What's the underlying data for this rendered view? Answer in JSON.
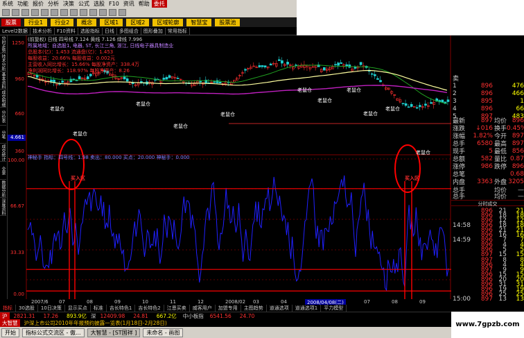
{
  "menu": [
    "系统",
    "功能",
    "报价",
    "分析",
    "决策",
    "公式",
    "选股",
    "F10",
    "资讯",
    "帮助",
    "委托"
  ],
  "toolbar_icons": [
    "open-icon",
    "save-icon",
    "kline-icon",
    "rsi-icon",
    "grid-icon",
    "cross-icon",
    "zoom-in-icon",
    "zoom-out-icon",
    "prev-icon",
    "next-icon",
    "period-icon",
    "search-icon",
    "refresh-icon"
  ],
  "tabs": [
    "股票",
    "行业1",
    "行业2",
    "概念",
    "区域1",
    "区域2",
    "区域轮廓",
    "智慧宝",
    "股票池"
  ],
  "subbar": [
    "Level2数据",
    "技术分析",
    "F10资料",
    "选股指标",
    "日线",
    "多图组合",
    "图形叠加",
    "常用指标"
  ],
  "leftnav": [
    "分时走势",
    "技术分析",
    "基本资料",
    "成交明细",
    "分价表",
    "分笔",
    "成交统计",
    "全景",
    "数据分析",
    "深度资料"
  ],
  "chart": {
    "header": "(前复权)  日线  四号线 7.124  黄线  7.126  绿线 7.996",
    "info_lines": [
      "所属地域：自选股1, 电器, ST, 长江三角, 浙江, 日线电子器具制造业",
      "总股本(亿)：1.453    流通盘(亿)：1.453",
      "每股收益：20.66%    每股收益：0.002元",
      "主营收入同比增长：15.66%  每股净资产：338.4万",
      "净利润同比增长：118.97%  每股净资产：8.26"
    ],
    "kline_axis": [
      "1250",
      "960",
      "660",
      "360"
    ],
    "kline_axis_value": "4.661",
    "labels": [
      "老鼠仓",
      "老鼠仓",
      "老鼠仓",
      "老鼠仓",
      "老鼠仓",
      "老鼠仓",
      "老鼠仓",
      "老鼠仓",
      "老鼠仓",
      "老鼠仓",
      "老鼠仓"
    ],
    "osc_header": "神秘手  指标：四号线：1.98  卖出：80.000  买点：20.000  神秘手：0.000",
    "osc_axis": [
      "100.00",
      "66.67",
      "33.33",
      "0.00"
    ],
    "buy_label_left": "买入区",
    "buy_label_right": "买入区",
    "current_date": "2008/04/08(二)",
    "x_labels": [
      "2007/6",
      "07",
      "08",
      "09",
      "10",
      "11",
      "12",
      "2008/02",
      "03",
      "04",
      "05",
      "06",
      "07",
      "08",
      "09"
    ]
  },
  "quote_rows": [
    {
      "n": "卖",
      "p": "",
      "v": "",
      "q": ""
    },
    {
      "n": "1",
      "p": "896",
      "v": "",
      "q": "476"
    },
    {
      "n": "2",
      "p": "896",
      "v": "",
      "q": "466"
    },
    {
      "n": "3",
      "p": "895",
      "v": "",
      "q": "1"
    },
    {
      "n": "4",
      "p": "896",
      "v": "",
      "q": "66"
    },
    {
      "n": "5",
      "p": "897",
      "v": "",
      "q": "483"
    }
  ],
  "stat_rows": [
    {
      "a": "最新",
      "b": "897",
      "c": "均价",
      "d": "896"
    },
    {
      "a": "涨跌",
      "b": "↓016",
      "c": "换手",
      "d": "0.45%"
    },
    {
      "a": "涨幅",
      "b": "1.82%",
      "c": "今开",
      "d": "897"
    },
    {
      "a": "总手",
      "b": "6580",
      "c": "最高",
      "d": "897"
    },
    {
      "a": "现手",
      "b": "5",
      "c": "最低",
      "d": "856"
    },
    {
      "a": "总额",
      "b": "582",
      "c": "量比",
      "d": "0.87"
    },
    {
      "a": "涨停",
      "b": "986",
      "c": "跌停",
      "d": "896"
    },
    {
      "a": "总笔",
      "b": "",
      "c": "",
      "d": "0.68"
    },
    {
      "a": "内盘",
      "b": "3363",
      "c": "外盘",
      "d": "3205"
    }
  ],
  "avg_rows": [
    {
      "a": "总手",
      "b": "",
      "c": "均价",
      "d": "—"
    },
    {
      "a": "总手",
      "b": "",
      "c": "均价",
      "d": "—"
    }
  ],
  "tick_title": "分时成交",
  "ticks": [
    {
      "t": "",
      "p": "896",
      "v": "21"
    },
    {
      "t": "",
      "p": "896",
      "v": "18"
    },
    {
      "t": "",
      "p": "896",
      "v": "12"
    },
    {
      "t": "14:58",
      "p": "896",
      "v": "18"
    },
    {
      "t": "",
      "p": "896",
      "v": "21"
    },
    {
      "t": "",
      "p": "896",
      "v": "16"
    },
    {
      "t": "14:59",
      "p": "896",
      "v": "7"
    },
    {
      "t": "",
      "p": "896",
      "v": "4"
    },
    {
      "t": "",
      "p": "896",
      "v": "5"
    },
    {
      "t": "",
      "p": "897",
      "v": "15"
    },
    {
      "t": "",
      "p": "897",
      "v": "8"
    },
    {
      "t": "",
      "p": "896",
      "v": "4"
    },
    {
      "t": "",
      "p": "897",
      "v": "9"
    },
    {
      "t": "",
      "p": "896",
      "v": "15"
    },
    {
      "t": "",
      "p": "896",
      "v": "20"
    },
    {
      "t": "",
      "p": "896",
      "v": "31"
    },
    {
      "t": "",
      "p": "896",
      "v": "19"
    },
    {
      "t": "",
      "p": "896",
      "v": "25"
    },
    {
      "t": "15:00",
      "p": "897",
      "v": "13"
    }
  ],
  "bottom_tabs": [
    "指标",
    "30选股",
    "10日决策",
    "显示买点",
    "标准",
    "吉长特色1",
    "吉长特色2",
    "江恩买卖",
    "威客用户",
    "加盟专用",
    "主图趋势",
    "道通选项",
    "道通选项1",
    "平力模型"
  ],
  "ticker": {
    "sh_label": "沪",
    "sh_val": "2821.31",
    "sh_chg": "17.26",
    "sh_amt": "893.9亿",
    "sz_label": "深",
    "sz_val": "12409.98",
    "sz_chg": "24.81",
    "sz_amt": "667.2亿",
    "sz_board": "中小板指",
    "sz_board_val": "6541.56",
    "sz_board_chg": "24.70"
  },
  "news": "沪深上市公司2010年年报预约披露一览表(1月18日-2月28日)",
  "news_tag": "大智慧",
  "taskbar": [
    "开始",
    "指标公式交流区 - 傲...",
    "大智慧 - [ST国祥 ]",
    "未命名 - 画图"
  ],
  "watermark": "www.7gpzb.com",
  "colors": {
    "bg": "#000000",
    "up": "#ff3030",
    "down": "#20c020",
    "ma1": "#ffffa0",
    "ma2": "#c020c0",
    "ma3": "#20a020",
    "osc": "#2020ff",
    "annot": "#ff0000"
  }
}
